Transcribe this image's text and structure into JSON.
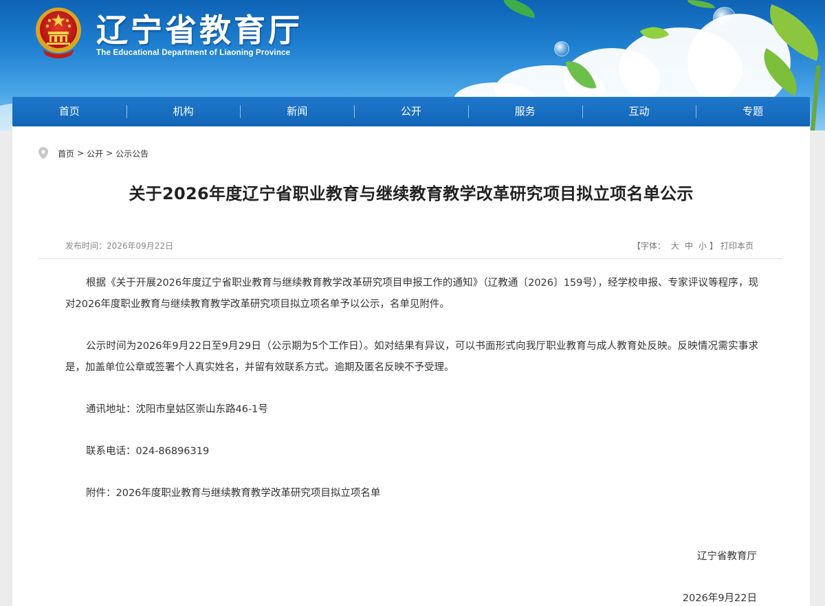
{
  "header": {
    "site_title": "辽宁省教育厅",
    "site_subtitle": "The Educational Department of Liaoning Province",
    "emblem_icon": "national-emblem-icon"
  },
  "nav": {
    "items": [
      "首页",
      "机构",
      "新闻",
      "公开",
      "服务",
      "互动",
      "专题"
    ]
  },
  "breadcrumb": {
    "icon": "location-pin-icon",
    "items": [
      "首页",
      "公开",
      "公示公告"
    ],
    "separator": ">"
  },
  "article": {
    "title": "关于2026年度辽宁省职业教育与继续教育教学改革研究项目拟立项名单公示",
    "publish_time": "发布时间：2026年09月22日",
    "tools": {
      "font_label": "【字体：",
      "size_large": "大",
      "size_medium": "中",
      "size_small": "小",
      "close_bracket": "】",
      "print": "打印本页"
    },
    "paragraphs": [
      "根据《关于开展2026年度辽宁省职业教育与继续教育教学改革研究项目申报工作的通知》（辽教通〔2026〕159号），经学校申报、专家评议等程序，现对2026年度职业教育与继续教育教学改革研究项目拟立项名单予以公示，名单见附件。",
      "公示时间为2026年9月22日至9月29日（公示期为5个工作日）。如对结果有异议，可以书面形式向我厅职业教育与成人教育处反映。反映情况需实事求是，加盖单位公章或签署个人真实姓名，并留有效联系方式。逾期及匿名反映不予受理。"
    ],
    "address": "通讯地址：沈阳市皇姑区崇山东路46-1号",
    "phone": "联系电话：024-86896319",
    "attachment": "附件：2026年度职业教育与继续教育教学改革研究项目拟立项名单",
    "signature": "辽宁省教育厅",
    "date": "2026年9月22日"
  },
  "colors": {
    "nav_blue": "#1265b7",
    "banner_blue": "#1f7fd0",
    "text": "#333333"
  }
}
